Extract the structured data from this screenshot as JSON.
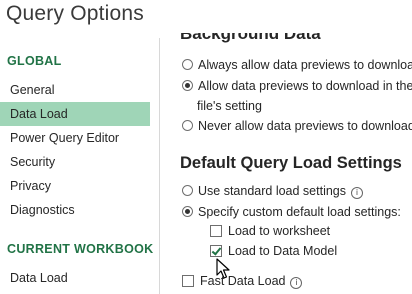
{
  "window": {
    "title": "Query Options"
  },
  "sidebar": {
    "global_heading": "GLOBAL",
    "global_items": [
      {
        "label": "General",
        "selected": false
      },
      {
        "label": "Data Load",
        "selected": true
      },
      {
        "label": "Power Query Editor",
        "selected": false
      },
      {
        "label": "Security",
        "selected": false
      },
      {
        "label": "Privacy",
        "selected": false
      },
      {
        "label": "Diagnostics",
        "selected": false
      }
    ],
    "workbook_heading": "CURRENT WORKBOOK",
    "workbook_items": [
      {
        "label": "Data Load",
        "selected": false
      }
    ]
  },
  "main": {
    "background_heading": "Background Data",
    "background_options": [
      {
        "label": "Always allow data previews to download",
        "selected": false
      },
      {
        "label": "Allow data previews to download in the b",
        "selected": true
      },
      {
        "label": "file's setting"
      },
      {
        "label": "Never allow data previews to download i",
        "selected": false
      }
    ],
    "load_heading": "Default Query Load Settings",
    "load_options": [
      {
        "label": "Use standard load settings",
        "selected": false,
        "info_icon": "info-icon"
      },
      {
        "label": "Specify custom default load settings:",
        "selected": true
      }
    ],
    "custom_checks": [
      {
        "label": "Load to worksheet",
        "checked": false
      },
      {
        "label": "Load to Data Model",
        "checked": true
      }
    ],
    "fast_load": {
      "label": "Fast Data Load",
      "checked": false,
      "info_icon": "info-icon"
    }
  },
  "colors": {
    "accent": "#217346",
    "selection": "#9fd5b7"
  }
}
